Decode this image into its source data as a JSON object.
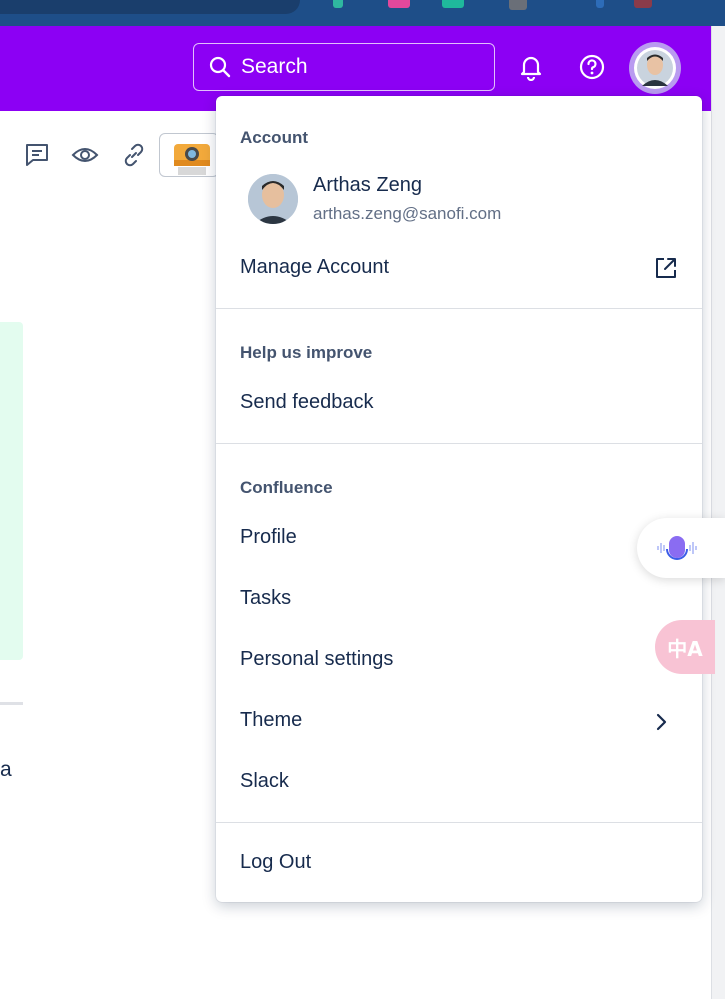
{
  "header": {
    "search_label": "Search"
  },
  "menu": {
    "account": {
      "title": "Account",
      "user_name": "Arthas Zeng",
      "user_email": "arthas.zeng@sanofi.com",
      "manage_label": "Manage Account"
    },
    "help": {
      "title": "Help us improve",
      "feedback_label": "Send feedback"
    },
    "confluence": {
      "title": "Confluence",
      "items": [
        "Profile",
        "Tasks",
        "Personal settings",
        "Theme",
        "Slack"
      ]
    },
    "logout_label": "Log Out"
  },
  "page": {
    "text_fragment": "a"
  },
  "floating": {
    "translate_label": "中A"
  },
  "colors": {
    "header_bg": "#8c00f4",
    "menu_text": "#172b4d",
    "section_title": "#44546f",
    "mint_panel": "#e3fcef"
  }
}
